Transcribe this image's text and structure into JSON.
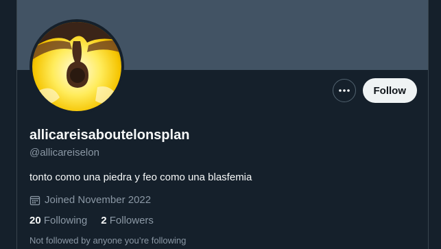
{
  "profile": {
    "display_name": "allicareisaboutelonsplan",
    "handle": "@allicareiselon",
    "bio": "tonto como una piedra y feo como una blasfemia",
    "joined": "Joined November 2022",
    "following_count": "20",
    "following_label": "Following",
    "followers_count": "2",
    "followers_label": "Followers",
    "follow_note": "Not followed by anyone you’re following"
  },
  "actions": {
    "follow_label": "Follow",
    "more_icon": "more-dots-icon"
  },
  "colors": {
    "background": "#15202b",
    "banner": "#425364",
    "follow_button": "#eff3f4",
    "secondary_text": "#8b98a5"
  }
}
